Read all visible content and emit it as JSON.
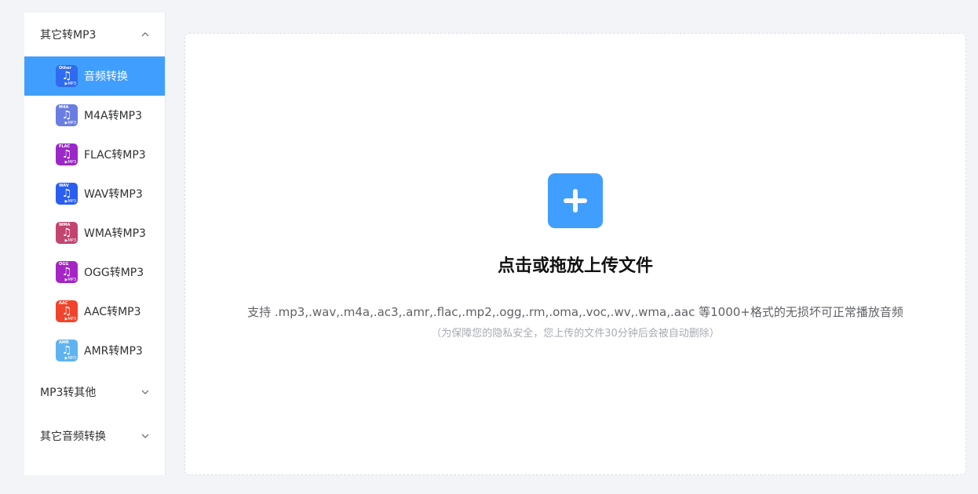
{
  "sidebar": {
    "groups": [
      {
        "label": "其它转MP3",
        "expanded": true,
        "items": [
          {
            "label": "音频转换",
            "icon": "music-note-icon",
            "tag": "Other",
            "color": "#2f6bf0",
            "active": true
          },
          {
            "label": "M4A转MP3",
            "icon": "music-note-icon",
            "tag": "M4A",
            "color": "#6a7de0",
            "active": false
          },
          {
            "label": "FLAC转MP3",
            "icon": "music-note-icon",
            "tag": "FLAC",
            "color": "#9b27c7",
            "active": false
          },
          {
            "label": "WAV转MP3",
            "icon": "music-note-icon",
            "tag": "WAV",
            "color": "#2a5ef0",
            "active": false
          },
          {
            "label": "WMA转MP3",
            "icon": "music-note-icon",
            "tag": "WMA",
            "color": "#c2456e",
            "active": false
          },
          {
            "label": "OGG转MP3",
            "icon": "music-note-icon",
            "tag": "OGG",
            "color": "#a424c4",
            "active": false
          },
          {
            "label": "AAC转MP3",
            "icon": "music-note-icon",
            "tag": "AAC",
            "color": "#f0452c",
            "active": false
          },
          {
            "label": "AMR转MP3",
            "icon": "music-note-icon",
            "tag": "AMR",
            "color": "#5fb3ef",
            "active": false
          }
        ]
      },
      {
        "label": "MP3转其他",
        "expanded": false
      },
      {
        "label": "其它音频转换",
        "expanded": false
      }
    ],
    "mp3_badge": "▶MP3"
  },
  "upload": {
    "title": "点击或拖放上传文件",
    "description": "支持 .mp3,.wav,.m4a,.ac3,.amr,.flac,.mp2,.ogg,.rm,.oma,.voc,.wv,.wma,.aac 等1000+格式的无损坏可正常播放音频",
    "note": "（为保障您的隐私安全，您上传的文件30分钟后会被自动删除）",
    "icon": "plus-icon"
  },
  "colors": {
    "accent": "#409eff",
    "background": "#f3f4f8"
  }
}
